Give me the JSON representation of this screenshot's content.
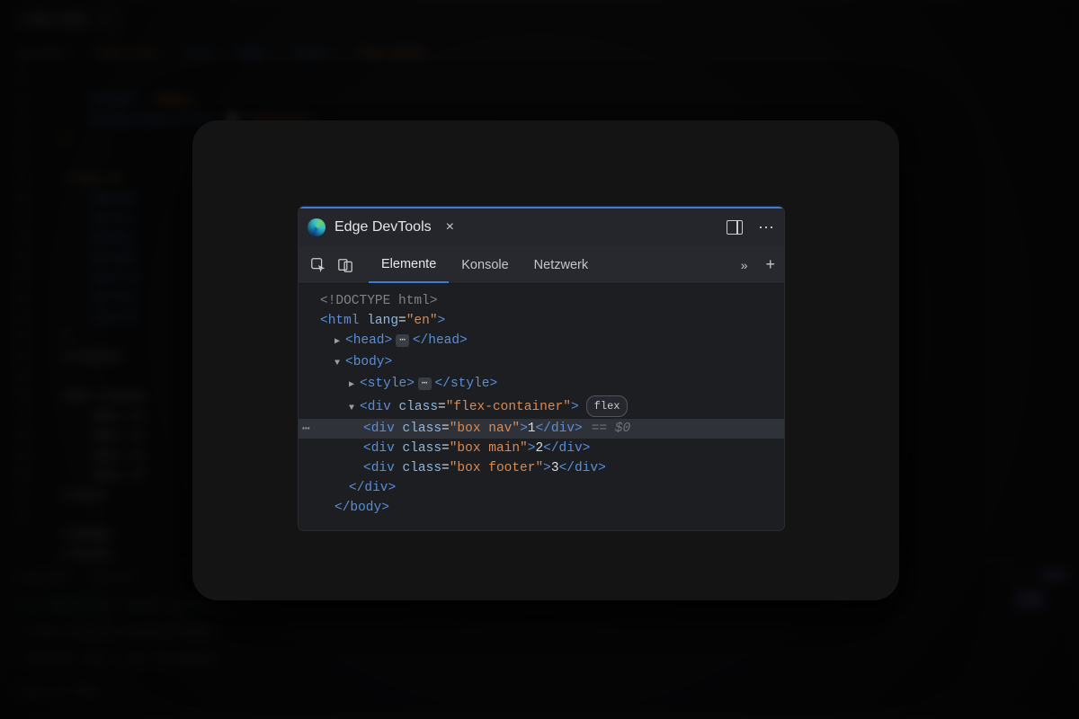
{
  "background_editor": {
    "tab": {
      "filename": "index.html",
      "close_glyph": "×"
    },
    "breadcrumbs": [
      "Flexbox",
      "index.html",
      "html",
      "body",
      "style",
      ".flex-child"
    ],
    "gutter_start": 19,
    "code_lines": [
      "    height: 200px;",
      "    background-color: ▢lightgray;",
      "}",
      "",
      ".flex-ch",
      "    backgr",
      "    color:",
      "    width:",
      "    height",
      "    text-a",
      "    vertic",
      "    line-h",
      "}",
      "</style>",
      "",
      "<div class=",
      "    <div cl",
      "    <div cl",
      "    <div cl",
      "    <div cl",
      "</div>",
      "",
      "</body>",
      "</html>"
    ],
    "terminal": {
      "tabs": [
        "PROBLEMS",
        "OUTPUT"
      ],
      "line1_prefix": "vite v2.9.15",
      "line1_rest": " dev server running at:",
      "line2": "> Local:  http://localhost:3000/",
      "line3": "> Network: use --host to expose",
      "line4": "ready in 75ms.",
      "right_items": [
        "zsh",
        "zsh"
      ]
    }
  },
  "devtools": {
    "product": "Edge DevTools",
    "close_glyph": "×",
    "tabs": [
      "Elemente",
      "Konsole",
      "Netzwerk"
    ],
    "active_tab_index": 0,
    "more_glyph": "»",
    "add_glyph": "+",
    "dots_glyph": "⋯",
    "flex_badge": "flex",
    "selected_ref": "== $0",
    "dom": {
      "l0": "<!DOCTYPE html>",
      "l1_open": "<",
      "l1_tag": "html",
      "l1_attr": " lang",
      "l1_eq": "=",
      "l1_val": "\"en\"",
      "l1_close": ">",
      "l2_head_open": "<head>",
      "l2_head_close": "</head>",
      "l3_body_open": "<body>",
      "l4_style_open": "<style>",
      "l4_style_close": "</style>",
      "l5_open": "<",
      "l5_tag": "div",
      "l5_attr": " class",
      "l5_val": "\"flex-container\"",
      "l5_close": ">",
      "l6_open": "<",
      "l6_tag": "div",
      "l6_attr": " class",
      "l6_val": "\"box nav\"",
      "l6_txt": "1",
      "l6_close": "</div>",
      "l7_open": "<",
      "l7_tag": "div",
      "l7_attr": " class",
      "l7_val": "\"box main\"",
      "l7_txt": "2",
      "l7_close": "</div>",
      "l8_open": "<",
      "l8_tag": "div",
      "l8_attr": " class",
      "l8_val": "\"box footer\"",
      "l8_txt": "3",
      "l8_close": "</div>",
      "l9": "</div>",
      "l10": "</body>"
    }
  }
}
